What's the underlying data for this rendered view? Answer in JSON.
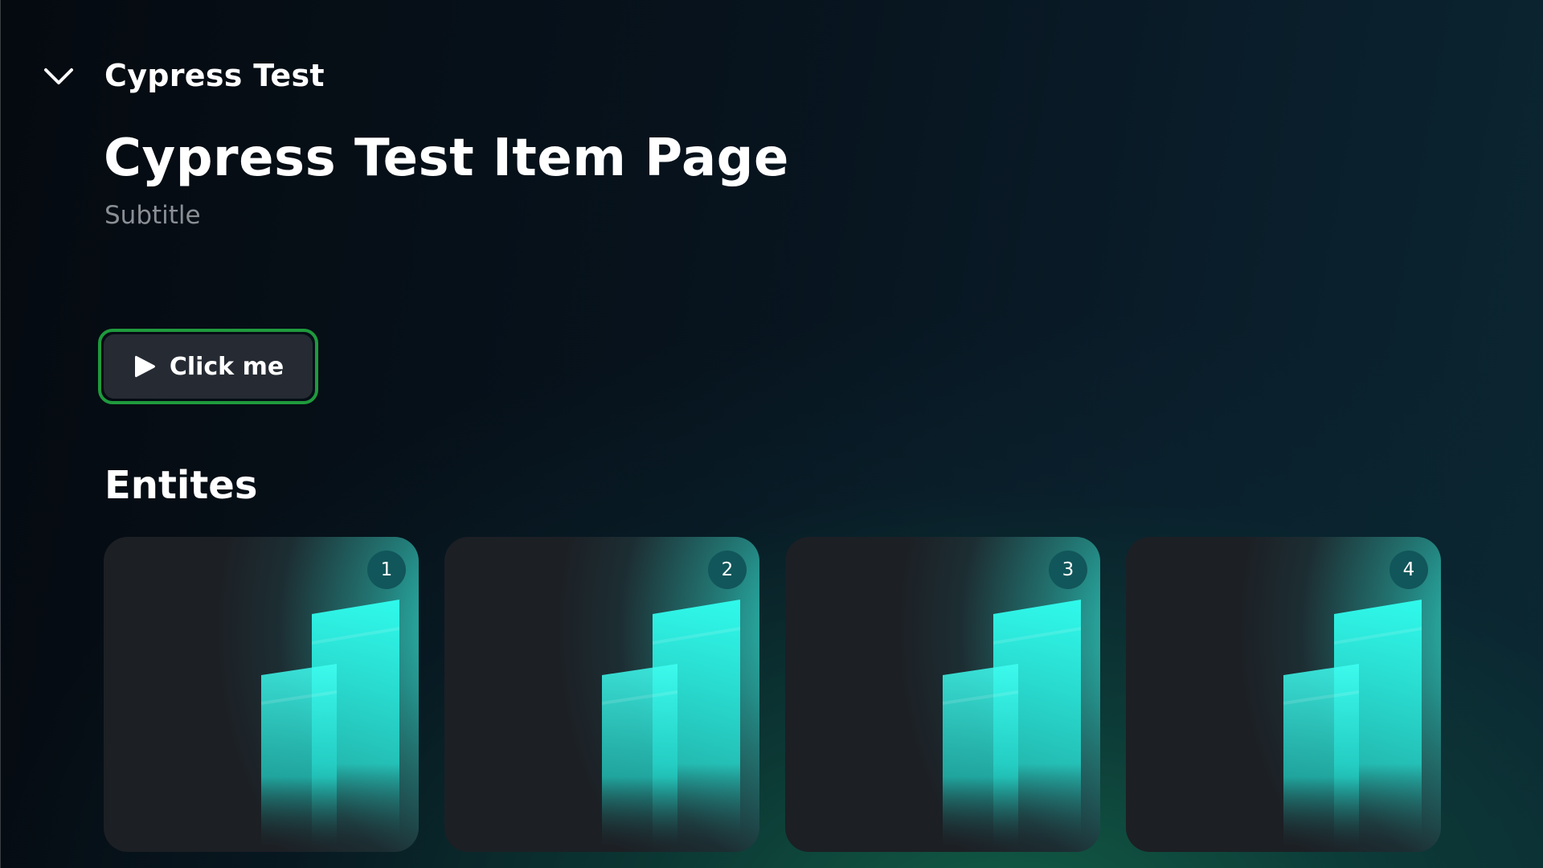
{
  "header": {
    "title": "Cypress Test",
    "collapse_icon": "chevron-down-icon"
  },
  "page": {
    "title": "Cypress Test Item Page",
    "subtitle": "Subtitle"
  },
  "primary_action": {
    "label": "Click me",
    "icon": "play-icon",
    "focus_color": "#1f9a3d"
  },
  "section": {
    "title": "Entites"
  },
  "cards": [
    {
      "index": "1"
    },
    {
      "index": "2"
    },
    {
      "index": "3"
    },
    {
      "index": "4"
    }
  ],
  "colors": {
    "accent": "#2fe8d8",
    "card_background": "#1c1f24",
    "badge_background": "#11565a"
  }
}
